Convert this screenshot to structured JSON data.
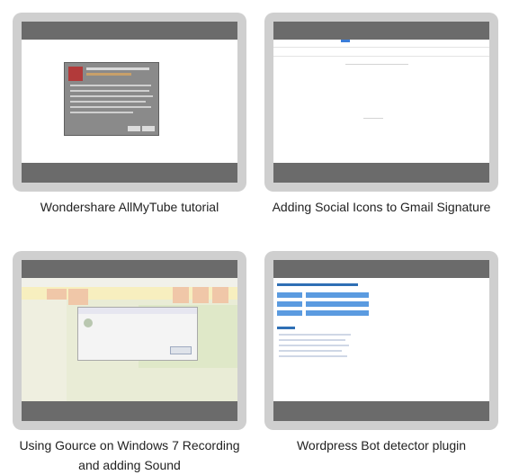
{
  "videos": [
    {
      "caption": "Wondershare AllMyTube tutorial"
    },
    {
      "caption": "Adding Social Icons to Gmail Signature"
    },
    {
      "caption": "Using Gource on Windows 7 Recording and adding Sound"
    },
    {
      "caption": "Wordpress Bot detector plugin"
    }
  ]
}
